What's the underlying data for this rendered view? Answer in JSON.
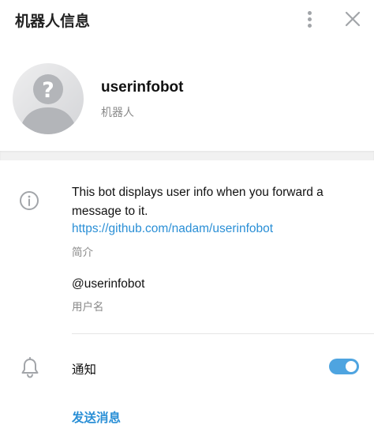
{
  "header": {
    "title": "机器人信息",
    "more_icon": "more-vertical-icon",
    "close_icon": "close-icon"
  },
  "profile": {
    "name": "userinfobot",
    "subtitle": "机器人",
    "avatar_icon": "user-placeholder-icon"
  },
  "info": {
    "icon": "info-icon",
    "description": "This bot displays user info when you forward a message to it.",
    "link": "https://github.com/nadam/userinfobot",
    "description_label": "简介",
    "username": "@userinfobot",
    "username_label": "用户名"
  },
  "notifications": {
    "icon": "bell-icon",
    "label": "通知",
    "enabled": true
  },
  "actions": {
    "send_message": "发送消息"
  },
  "colors": {
    "accent": "#2a8fd6",
    "toggle_on": "#4ea4e0",
    "secondary_text": "#8a8a8a",
    "icon_gray": "#a2a5a9"
  }
}
